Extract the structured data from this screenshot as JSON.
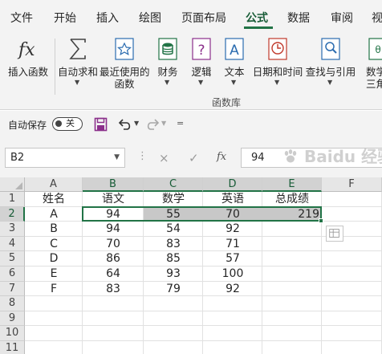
{
  "tabs": [
    "文件",
    "开始",
    "插入",
    "绘图",
    "页面布局",
    "公式",
    "数据",
    "审阅",
    "视"
  ],
  "active_tab": "公式",
  "ribbon": {
    "buttons": [
      {
        "name": "insert-function-button",
        "icon": "fx-icon",
        "label": "插入函数",
        "label2": ""
      },
      {
        "name": "autosum-button",
        "icon": "sigma-icon",
        "label": "自动求和",
        "label2": ""
      },
      {
        "name": "recently-used-button",
        "icon": "star-icon",
        "label": "最近使用的",
        "label2": "函数"
      },
      {
        "name": "financial-button",
        "icon": "financial-icon",
        "label": "财务",
        "label2": ""
      },
      {
        "name": "logical-button",
        "icon": "logical-icon",
        "label": "逻辑",
        "label2": ""
      },
      {
        "name": "text-button",
        "icon": "text-icon",
        "label": "文本",
        "label2": ""
      },
      {
        "name": "date-time-button",
        "icon": "clock-icon",
        "label": "日期和时间",
        "label2": ""
      },
      {
        "name": "lookup-reference-button",
        "icon": "lookup-icon",
        "label": "查找与引用",
        "label2": ""
      },
      {
        "name": "math-trig-button",
        "icon": "math-icon",
        "label": "数学",
        "label2": "三角函"
      }
    ],
    "group_label": "函数库"
  },
  "qat": {
    "autosave_label": "自动保存",
    "toggle_text": "关"
  },
  "formula_bar": {
    "name_box": "B2",
    "cancel_symbol": "×",
    "enter_symbol": "✓",
    "fx_symbol": "fx",
    "value": "94"
  },
  "columns": [
    "A",
    "B",
    "C",
    "D",
    "E",
    "F"
  ],
  "rows": [
    "1",
    "2",
    "3",
    "4",
    "5",
    "6",
    "7",
    "8",
    "9",
    "10",
    "11"
  ],
  "table": {
    "headers": [
      "姓名",
      "语文",
      "数学",
      "英语",
      "总成绩"
    ],
    "rows": [
      [
        "A",
        "94",
        "55",
        "70",
        "219"
      ],
      [
        "B",
        "94",
        "54",
        "92",
        ""
      ],
      [
        "C",
        "70",
        "83",
        "71",
        ""
      ],
      [
        "D",
        "86",
        "85",
        "57",
        ""
      ],
      [
        "E",
        "64",
        "93",
        "100",
        ""
      ],
      [
        "F",
        "83",
        "79",
        "92",
        ""
      ]
    ]
  },
  "selection": {
    "active_cell": "B2",
    "range": "B2:E2"
  },
  "colors": {
    "accent": "#217346",
    "ribbon_bg": "#f3f3f3",
    "selected_range": "#c8c8c8"
  },
  "watermark_text": "Baidu 经验"
}
